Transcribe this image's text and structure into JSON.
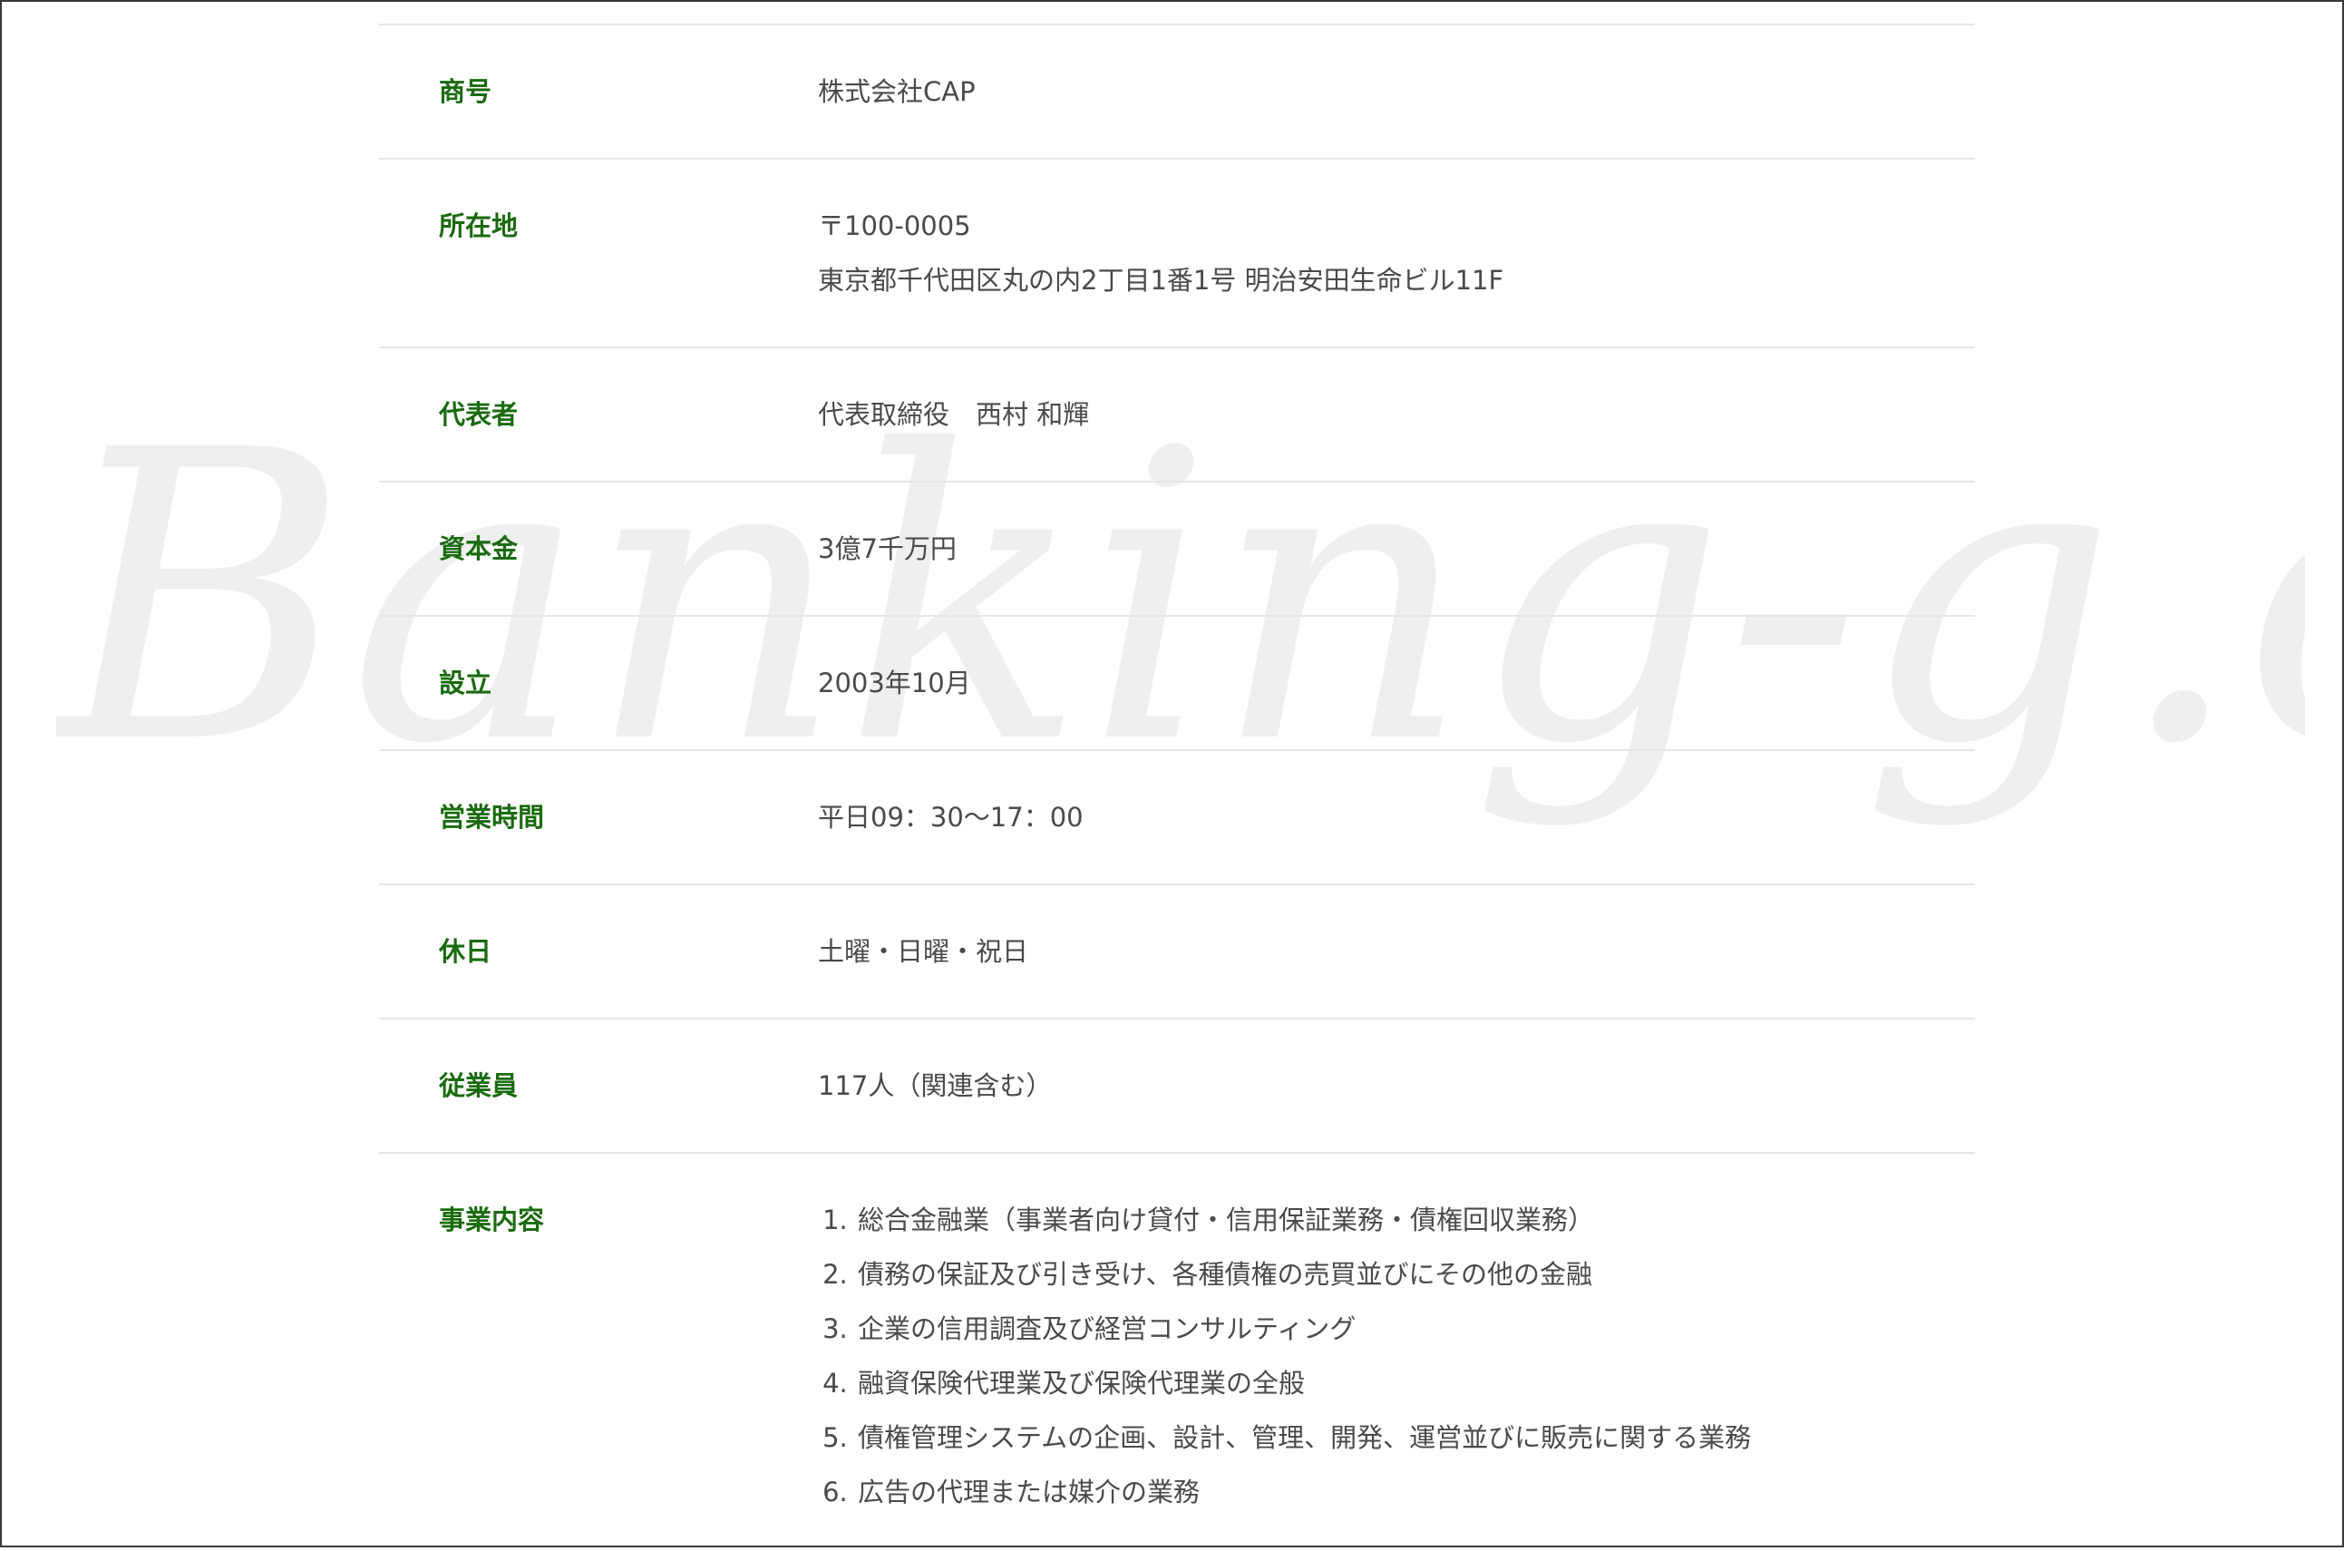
{
  "watermark": {
    "text": "Banking-g.com",
    "color": "#efefef"
  },
  "colors": {
    "label": "#1a6b0f",
    "value": "#4a4a4a",
    "divider": "#e6e6e6"
  },
  "company": {
    "rows": [
      {
        "label": "商号",
        "value": "株式会社CAP"
      },
      {
        "label": "所在地",
        "lines": [
          "〒100-0005",
          "東京都千代田区丸の内2丁目1番1号 明治安田生命ビル11F"
        ]
      },
      {
        "label": "代表者",
        "value": "代表取締役　西村 和輝"
      },
      {
        "label": "資本金",
        "value": "3億7千万円"
      },
      {
        "label": "設立",
        "value": "2003年10月"
      },
      {
        "label": "営業時間",
        "value": "平日09：30〜17：00"
      },
      {
        "label": "休日",
        "value": "土曜・日曜・祝日"
      },
      {
        "label": "従業員",
        "value": "117人（関連含む）"
      },
      {
        "label": "事業内容",
        "items": [
          "総合金融業（事業者向け貸付・信用保証業務・債権回収業務）",
          "債務の保証及び引き受け、各種債権の売買並びにその他の金融",
          "企業の信用調査及び経営コンサルティング",
          "融資保険代理業及び保険代理業の全般",
          "債権管理システムの企画、設計、管理、開発、運営並びに販売に関する業務",
          "広告の代理または媒介の業務"
        ]
      }
    ]
  }
}
